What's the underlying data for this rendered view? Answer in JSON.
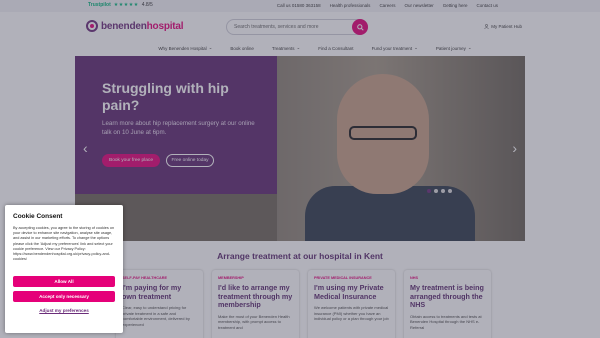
{
  "topbar": {
    "trustpilot_label": "Trustpilot",
    "stars": "★★★★★",
    "rating": "4.8/5",
    "phone": "Call us 01580 363158",
    "links": [
      "Health professionals",
      "Careers",
      "Our newsletter",
      "Getting here",
      "Contact us"
    ]
  },
  "header": {
    "brand_part1": "benenden",
    "brand_part2": "hospital",
    "search_placeholder": "Search treatments, services and more",
    "my_hub": "My Patient Hub"
  },
  "nav": {
    "items": [
      "Why Benenden Hospital",
      "Book online",
      "Treatments",
      "Find a Consultant",
      "Fund your treatment",
      "Patient journey"
    ]
  },
  "hero": {
    "title": "Struggling with hip pain?",
    "subtitle": "Learn more about hip replacement surgery at our online talk on 10 June at 6pm.",
    "book_button": "Book your free place",
    "online_button": "Free online today",
    "slide_count": 4,
    "active_slide": 1
  },
  "section": {
    "title": "Arrange treatment at our hospital in Kent",
    "cards": [
      {
        "tag": "SELF-PAY HEALTHCARE",
        "title": "I'm paying for my own treatment",
        "body": "Clear, easy to understand pricing for private treatment in a safe and comfortable environment, delivered by experienced"
      },
      {
        "tag": "MEMBERSHIP",
        "title": "I'd like to arrange my treatment through my membership",
        "body": "Make the most of your Benenden Health membership, with prompt access to treatment and"
      },
      {
        "tag": "PRIVATE MEDICAL INSURANCE",
        "title": "I'm using my Private Medical Insurance",
        "body": "We welcome patients with private medical insurance (PMI) whether you have an individual policy or a plan through your job"
      },
      {
        "tag": "NHS",
        "title": "My treatment is being arranged through the NHS",
        "body": "Obtain access to treatments and tests at Benenden Hospital through the NHS e-Referral"
      }
    ]
  },
  "cookie": {
    "title": "Cookie Consent",
    "text": "By accepting cookies, you agree to the storing of cookies on your device to enhance site navigation, analyse site usage, and assist in our marketing efforts. To change the options please click the 'Adjust my preferences' link and select your cookie preference. View our Privacy Policy: https://www.bendendenhospital.org.uk/privacy-policy-and-cookies/",
    "allow_all": "Allow All",
    "accept_necessary": "Accept only necessary",
    "adjust": "Adjust my preferences"
  },
  "colors": {
    "brand_purple": "#6b2d7a",
    "brand_pink": "#e50079",
    "hero_panel": "#5f2a70"
  }
}
